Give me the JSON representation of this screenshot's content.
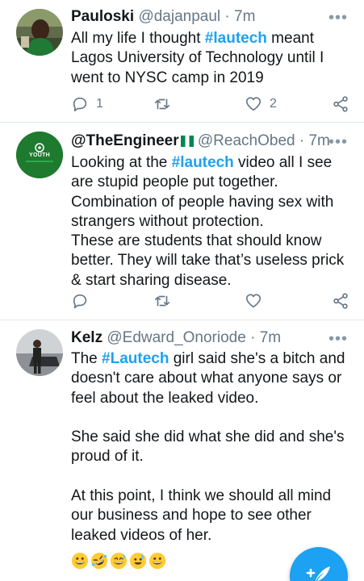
{
  "tweets": [
    {
      "name": "Pauloski",
      "handle": "@dajanpaul",
      "time": "· 7m",
      "text_before": "All my life I thought ",
      "hashtag": "#lautech",
      "text_after": " meant Lagos University of Technology until I went to NYSC camp in 2019",
      "replies": "1",
      "likes": "2"
    },
    {
      "name": "@TheEngineer",
      "flag": "🇳🇬",
      "handle": "@ReachObed",
      "time": "· 7m",
      "avatar_text": "YOUTH",
      "text_before": "Looking at the  ",
      "hashtag": "#lautech",
      "text_after": " video all I see are stupid people put together.",
      "line2": "Combination of people having sex with strangers without protection.",
      "line3": "These are students that should know better. They will take that’s useless prick & start sharing disease."
    },
    {
      "name": "Kelz",
      "handle": "@Edward_Onoriode",
      "time": "· 7m",
      "text_before": "The ",
      "hashtag": "#Lautech",
      "text_after": " girl said she's a bitch and doesn't care about what anyone says or feel about the leaked video.",
      "para2": "She said she did what she did and she's proud of it.",
      "para3": "At this point, I think we should all mind our business and hope to see other leaked videos of her.",
      "emojis": [
        "grinning",
        "rofl",
        "sweat-smile",
        "sweat",
        "grinning"
      ]
    }
  ],
  "icons": {
    "reply": "reply-icon",
    "retweet": "retweet-icon",
    "like": "heart-icon",
    "share": "share-icon",
    "compose": "compose-icon"
  },
  "colors": {
    "accent": "#1da1f2",
    "text": "#14171a",
    "muted": "#657786",
    "divider": "#e1e8ed",
    "youth_green": "#1e7a2e"
  }
}
